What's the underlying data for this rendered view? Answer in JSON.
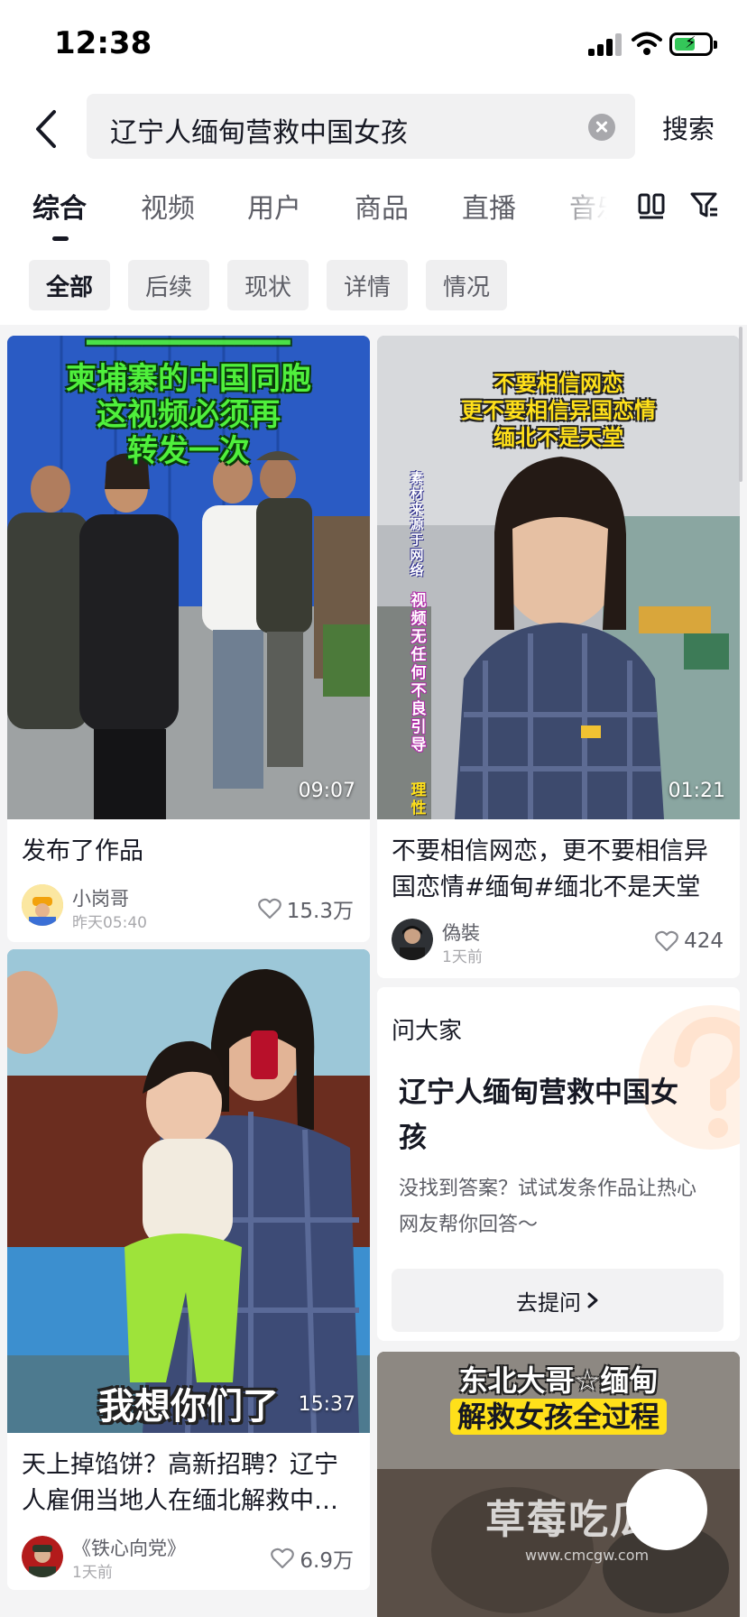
{
  "status_bar": {
    "time": "12:38"
  },
  "search": {
    "query": "辽宁人缅甸营救中国女孩",
    "submit_label": "搜索"
  },
  "tabs": [
    {
      "label": "综合",
      "active": true
    },
    {
      "label": "视频"
    },
    {
      "label": "用户"
    },
    {
      "label": "商品"
    },
    {
      "label": "直播"
    },
    {
      "label": "音乐"
    }
  ],
  "chips": [
    {
      "label": "全部",
      "active": true
    },
    {
      "label": "后续"
    },
    {
      "label": "现状"
    },
    {
      "label": "详情"
    },
    {
      "label": "情况"
    }
  ],
  "cards": [
    {
      "overlay_lines": [
        "柬埔寨的中国同胞",
        "这视频必须再",
        "转发一次"
      ],
      "duration": "09:07",
      "title": "发布了作品",
      "author": "小岗哥",
      "time": "昨天05:40",
      "likes": "15.3万"
    },
    {
      "overlay_lines": [
        "不要相信网恋",
        "更不要相信异国恋情",
        "缅北不是天堂"
      ],
      "side_text_1": "素材来源于网络",
      "side_text_2": "视频无任何不良引导",
      "side_text_3": "理性",
      "duration": "01:21",
      "title": "不要相信网恋，更不要相信异国恋情#缅甸#缅北不是天堂",
      "author": "偽裝",
      "time": "1天前",
      "likes": "424"
    },
    {
      "overlay_caption": "我想你们了",
      "duration": "15:37",
      "title": "天上掉馅饼？高新招聘？辽宁人雇佣当地人在缅北解救中…",
      "author": "《铁心向党》",
      "time": "1天前",
      "likes": "6.9万"
    },
    {
      "overlay_lines": [
        "东北大哥☆缅甸",
        "解救女孩全过程"
      ]
    }
  ],
  "ask": {
    "label": "问大家",
    "question": "辽宁人缅甸营救中国女孩",
    "hint": "没找到答案？试试发条作品让热心网友帮你回答～",
    "button": "去提问"
  },
  "watermark": {
    "text": "草莓吃瓜网",
    "url": "www.cmcgw.com"
  }
}
